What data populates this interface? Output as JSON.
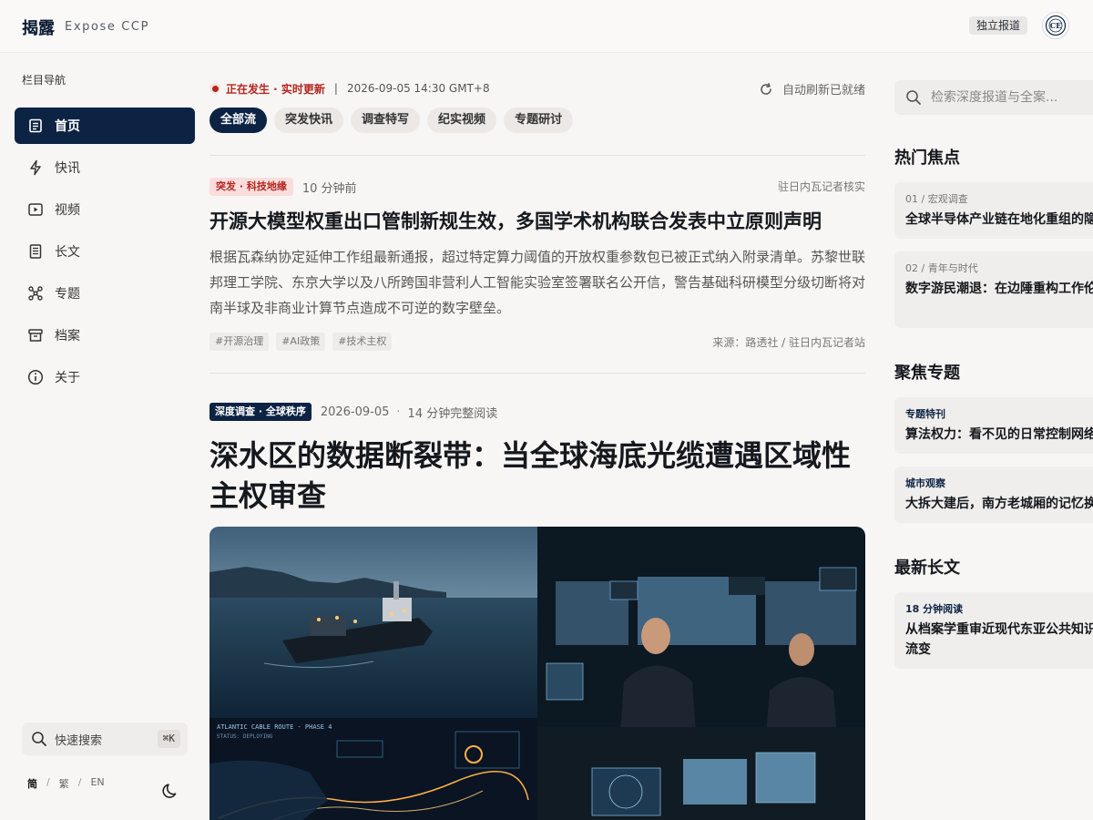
{
  "brand": {
    "name_cn": "揭露",
    "name_en": "Expose CCP"
  },
  "header": {
    "badge": "独立报道"
  },
  "sidebar": {
    "heading": "栏目导航",
    "items": [
      {
        "label": "首页",
        "icon": "document-icon",
        "active": true
      },
      {
        "label": "快讯",
        "icon": "lightning-icon"
      },
      {
        "label": "视频",
        "icon": "play-icon"
      },
      {
        "label": "长文",
        "icon": "longform-icon"
      },
      {
        "label": "专题",
        "icon": "network-icon"
      },
      {
        "label": "档案",
        "icon": "archive-icon"
      },
      {
        "label": "关于",
        "icon": "info-icon"
      }
    ],
    "quick_search": {
      "label": "快速搜索",
      "shortcut": "⌘K"
    },
    "languages": {
      "simplified": "简",
      "traditional": "繁",
      "english": "EN",
      "separator": "/"
    }
  },
  "live": {
    "status": "正在发生 · 实时更新",
    "separator": "|",
    "timestamp": "2026-09-05 14:30 GMT+8",
    "refresh": "自动刷新已就绪"
  },
  "filters": [
    "全部流",
    "突发快讯",
    "调查特写",
    "纪实视频",
    "专题研讨"
  ],
  "article1": {
    "tag": "突发 · 科技地缘",
    "time_ago": "10 分钟前",
    "verified_by": "驻日内瓦记者核实",
    "headline": "开源大模型权重出口管制新规生效，多国学术机构联合发表中立原则声明",
    "summary": "根据瓦森纳协定延伸工作组最新通报，超过特定算力阈值的开放权重参数包已被正式纳入附录清单。苏黎世联邦理工学院、东京大学以及八所跨国非营利人工智能实验室签署联名公开信，警告基础科研模型分级切断将对南半球及非商业计算节点造成不可逆的数字壁垒。",
    "hashtags": [
      "#开源治理",
      "#AI政策",
      "#技术主权"
    ],
    "source": "来源：路透社 / 驻日内瓦记者站"
  },
  "article2": {
    "tag": "深度调查 · 全球秩序",
    "date": "2026-09-05",
    "dot": "·",
    "read_time": "14 分钟完整阅读",
    "headline": "深水区的数据断裂带：当全球海底光缆遭遇区域性主权审查",
    "hero_overlay": {
      "route": "ATLANTIC CABLE ROUTE - PHASE 4",
      "status": "STATUS: DEPLOYING"
    }
  },
  "right": {
    "search_placeholder": "检索深度报道与全案...",
    "hot_title": "热门焦点",
    "hot": [
      {
        "kicker": "01 / 宏观调查",
        "title": "全球半导体产业链在地化重组的隐"
      },
      {
        "kicker": "02 / 青年与时代",
        "title": "数字游民潮退：在边陲重构工作伦人"
      }
    ],
    "topics_title": "聚焦专题",
    "topics": [
      {
        "kicker": "专题特刊",
        "title": "算法权力：看不见的日常控制网络"
      },
      {
        "kicker": "城市观察",
        "title": "大拆大建后，南方老城厢的记忆换"
      }
    ],
    "longform_title": "最新长文",
    "longform": [
      {
        "kicker": "18 分钟阅读",
        "title": "从档案学重审近现代东亚公共知识战流变"
      }
    ]
  },
  "colors": {
    "navy": "#0d2344",
    "alert_red": "#b3261e",
    "background": "#f8f6f5"
  }
}
